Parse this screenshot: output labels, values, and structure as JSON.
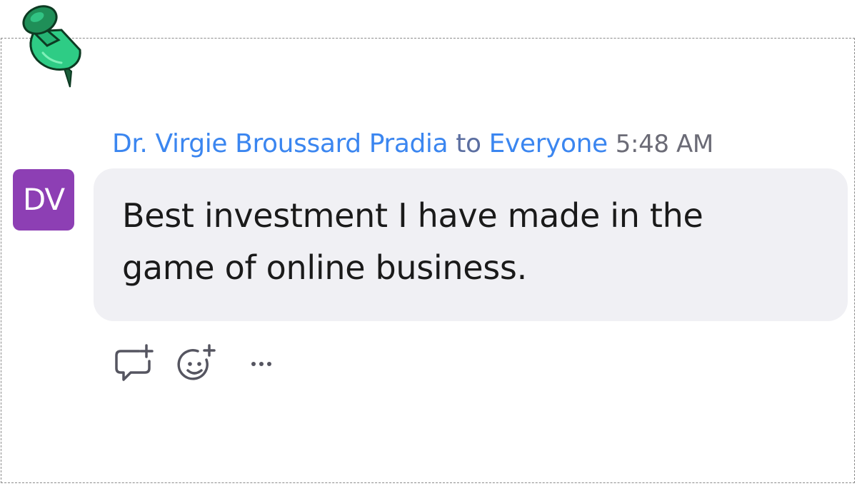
{
  "message": {
    "sender": "Dr. Virgie Broussard Pradia",
    "to_word": "to",
    "recipient": "Everyone",
    "time": "5:48 AM",
    "avatar_initials": "DV",
    "text_line1": "Best investment I have made in the",
    "text_line2": "game of online business."
  },
  "actions": [
    {
      "icon": "reply-bubble-plus-icon"
    },
    {
      "icon": "add-reaction-icon"
    },
    {
      "icon": "more-options-icon"
    }
  ],
  "colors": {
    "sender": "#3b86f0",
    "avatar_bg": "#8d3fb4",
    "bubble_bg": "#f0f0f4",
    "pin_green": "#2ecc85",
    "pin_dark": "#1b7a4a"
  }
}
